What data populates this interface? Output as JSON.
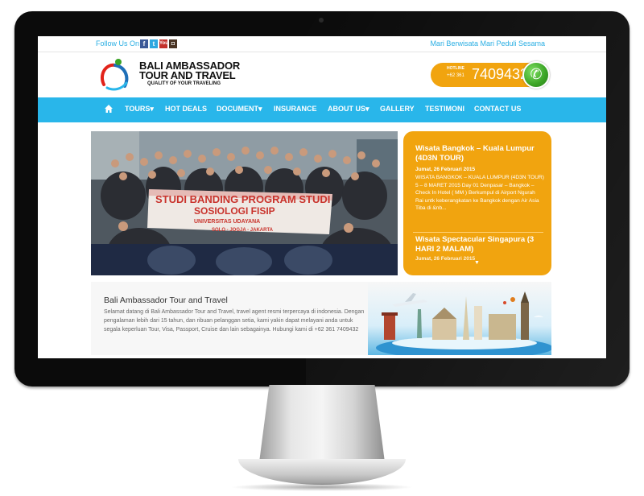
{
  "topbar": {
    "follow_label": "Follow Us On",
    "social": [
      {
        "icon": "facebook-icon",
        "glyph": "f"
      },
      {
        "icon": "twitter-icon",
        "glyph": "t"
      },
      {
        "icon": "youtube-icon",
        "glyph": "You"
      },
      {
        "icon": "instagram-icon",
        "glyph": "◘"
      }
    ],
    "slogan": "Mari Berwisata Mari Peduli Sesama"
  },
  "brand": {
    "line1": "BALI AMBASSADOR",
    "line2": "TOUR AND TRAVEL",
    "tagline": "QUALITY OF YOUR TRAVELING"
  },
  "hotline": {
    "label": "HOTLINE",
    "prefix": "+62 361",
    "number": "7409432",
    "icon": "phone-icon"
  },
  "nav": {
    "home_icon": "home-icon",
    "items": [
      {
        "label": "TOURS",
        "dropdown": true
      },
      {
        "label": "HOT DEALS",
        "dropdown": false
      },
      {
        "label": "DOCUMENT",
        "dropdown": true
      },
      {
        "label": "INSURANCE",
        "dropdown": false
      },
      {
        "label": "ABOUT US",
        "dropdown": true
      },
      {
        "label": "GALLERY",
        "dropdown": false
      },
      {
        "label": "TESTIMONI",
        "dropdown": false
      },
      {
        "label": "CONTACT US",
        "dropdown": false
      }
    ]
  },
  "slider": {
    "banner_line1": "STUDI BANDING PROGRAM STUDI",
    "banner_line2": "SOSIOLOGI FISIP",
    "banner_line3": "UNIVERSITAS UDAYANA",
    "banner_line4": "SOLO - JOGJA - JAKARTA"
  },
  "news": {
    "items": [
      {
        "title": "Wisata Bangkok – Kuala Lumpur (4D3N TOUR)",
        "date": "Jumat, 26 Februari 2015",
        "excerpt": "WISATA BANGKOK – KUALA LUMPUR (4D3N TOUR) 5 – 8 MARET 2015   Day 01 Denpasar – Bangkok – Check In Hotel ( MM ) Berkumpul di Airport Ngurah Rai untk keberangkatan ke Bangkok dengan Air Asia Tiba di &nb..."
      },
      {
        "title": "Wisata Spectacular Singapura (3 HARI 2 MALAM)",
        "date": "Jumat, 26 Februari 2015"
      }
    ],
    "scroll_icon": "chevron-down-icon"
  },
  "welcome": {
    "title": "Bali Ambassador Tour and Travel",
    "text": "Selamat datang di Bali Ambassador Tour and Travel, travel agent resmi terpercaya di indonesia. Dengan pengalaman lebih dari 15 tahun, dan ribuan pelanggan setia, kami yakin dapat melayani anda untuk segala keperluan Tour, Visa, Passport, Cruise dan lain sebagainya. Hubungi kami di +62 361 7409432"
  },
  "colors": {
    "accent_blue": "#29b6ea",
    "accent_orange": "#f1a40f",
    "phone_green": "#3aa324"
  }
}
